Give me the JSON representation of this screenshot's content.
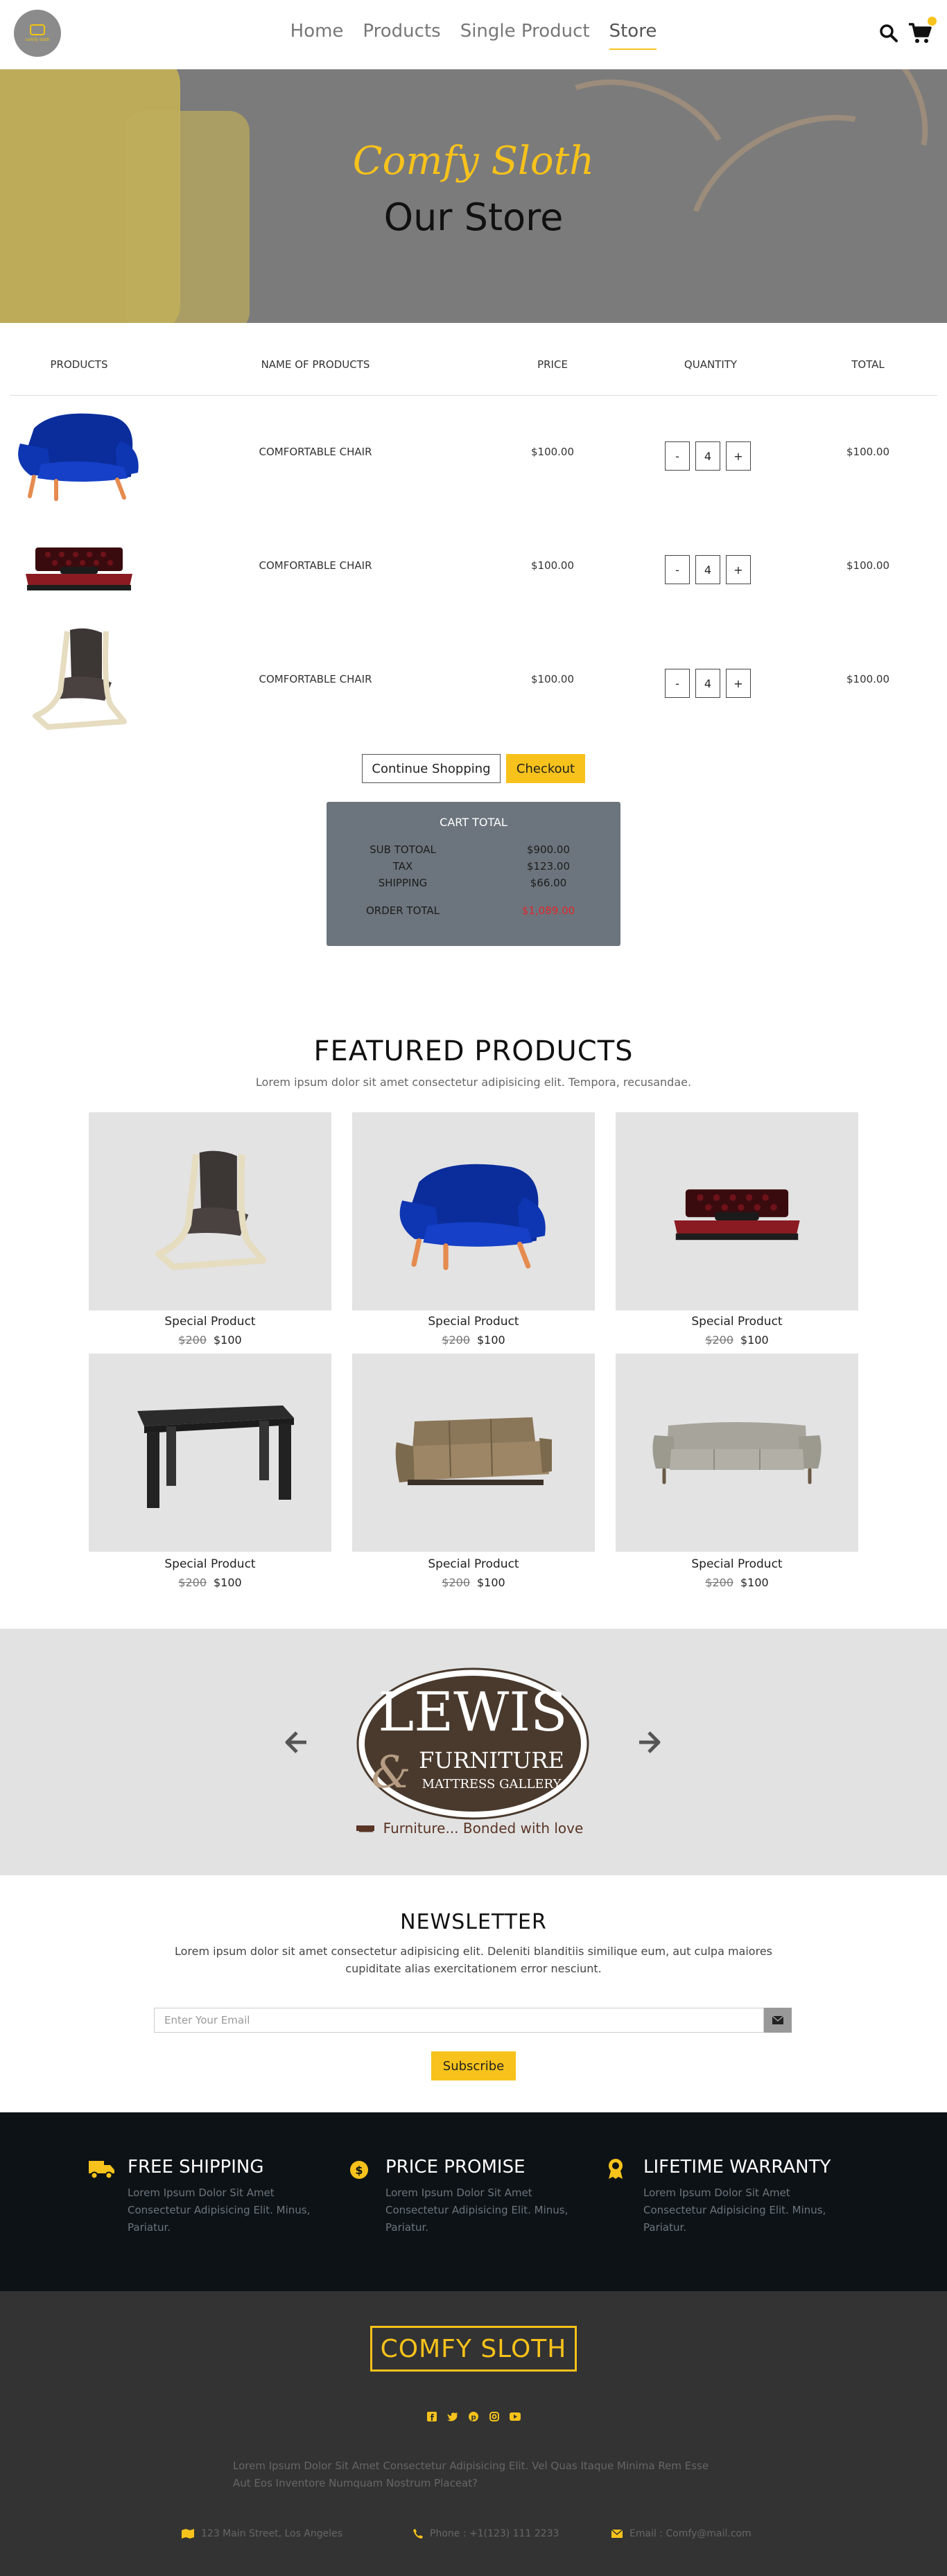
{
  "nav": {
    "logo_text": "comfy sloth",
    "links": [
      "Home",
      "Products",
      "Single Product",
      "Store"
    ],
    "active_index": 3,
    "cart_count_indicator": true
  },
  "hero": {
    "subtitle": "Comfy Sloth",
    "title": "Our Store"
  },
  "cart": {
    "headers": [
      "PRODUCTS",
      "NAME OF PRODUCTS",
      "PRICE",
      "QUANTITY",
      "TOTAL"
    ],
    "rows": [
      {
        "image": "blue-armchair",
        "name": "COMFORTABLE CHAIR",
        "price": "$100.00",
        "qty": "4",
        "total": "$100.00"
      },
      {
        "image": "red-bed",
        "name": "COMFORTABLE CHAIR",
        "price": "$100.00",
        "qty": "4",
        "total": "$100.00"
      },
      {
        "image": "lounge-chair",
        "name": "COMFORTABLE CHAIR",
        "price": "$100.00",
        "qty": "4",
        "total": "$100.00"
      }
    ],
    "minus_label": "-",
    "plus_label": "+",
    "continue_label": "Continue Shopping",
    "checkout_label": "Checkout"
  },
  "totals": {
    "title": "CART TOTAL",
    "subtotal_label": "SUB TOTOAL",
    "subtotal": "$900.00",
    "tax_label": "TAX",
    "tax": "$123.00",
    "shipping_label": "SHIPPING",
    "shipping": "$66.00",
    "order_label": "ORDER TOTAL",
    "order_total": "$1,089.00",
    "order_total_color": "#e0262e"
  },
  "featured": {
    "title": "FEATURED PRODUCTS",
    "subtitle": "Lorem ipsum dolor sit amet consectetur adipisicing elit. Tempora, recusandae.",
    "products": [
      {
        "image": "lounge-chair",
        "name": "Special Product",
        "old_price": "$200",
        "price": "$100"
      },
      {
        "image": "blue-armchair",
        "name": "Special Product",
        "old_price": "$200",
        "price": "$100"
      },
      {
        "image": "red-bed",
        "name": "Special Product",
        "old_price": "$200",
        "price": "$100"
      },
      {
        "image": "black-table",
        "name": "Special Product",
        "old_price": "$200",
        "price": "$100"
      },
      {
        "image": "brown-sofa",
        "name": "Special Product",
        "old_price": "$200",
        "price": "$100"
      },
      {
        "image": "grey-sofa",
        "name": "Special Product",
        "old_price": "$200",
        "price": "$100"
      }
    ]
  },
  "brand": {
    "name_line1": "LEWIS",
    "name_line2": "FURNITURE",
    "name_line3": "MATTRESS GALLERY",
    "ampersand": "&",
    "tagline": "Furniture... Bonded with love",
    "prev_icon": "arrow-left-icon",
    "next_icon": "arrow-right-icon"
  },
  "newsletter": {
    "title": "NEWSLETTER",
    "text": "Lorem ipsum dolor sit amet consectetur adipisicing elit. Deleniti blanditiis similique eum, aut culpa maiores cupiditate alias exercitationem error nesciunt.",
    "placeholder": "Enter Your Email",
    "email_value": "",
    "subscribe_label": "Subscribe"
  },
  "features": [
    {
      "icon": "truck-icon",
      "title": "FREE SHIPPING",
      "text": "Lorem Ipsum Dolor Sit Amet Consectetur Adipisicing Elit. Minus, Pariatur."
    },
    {
      "icon": "dollar-tag-icon",
      "title": "PRICE PROMISE",
      "text": "Lorem Ipsum Dolor Sit Amet Consectetur Adipisicing Elit. Minus, Pariatur."
    },
    {
      "icon": "award-icon",
      "title": "LIFETIME WARRANTY",
      "text": "Lorem Ipsum Dolor Sit Amet Consectetur Adipisicing Elit. Minus, Pariatur."
    }
  ],
  "footer": {
    "logo": "COMFY SLOTH",
    "socials": [
      "facebook-icon",
      "twitter-icon",
      "pinterest-icon",
      "instagram-icon",
      "youtube-icon"
    ],
    "text": "Lorem Ipsum Dolor Sit Amet Consectetur Adipisicing Elit. Vel Quas Itaque Minima Rem Esse Aut Eos Inventore Numquam Nostrum Placeat?",
    "address": "123 Main Street, Los Angeles",
    "phone": "Phone : +1(123) 111 2233",
    "email": "Email : Comfy@mail.com"
  },
  "colors": {
    "accent": "#f7c21b",
    "totals_bg": "#6c757d",
    "strip_bg": "#0d1216",
    "footer_bg": "#333333"
  }
}
